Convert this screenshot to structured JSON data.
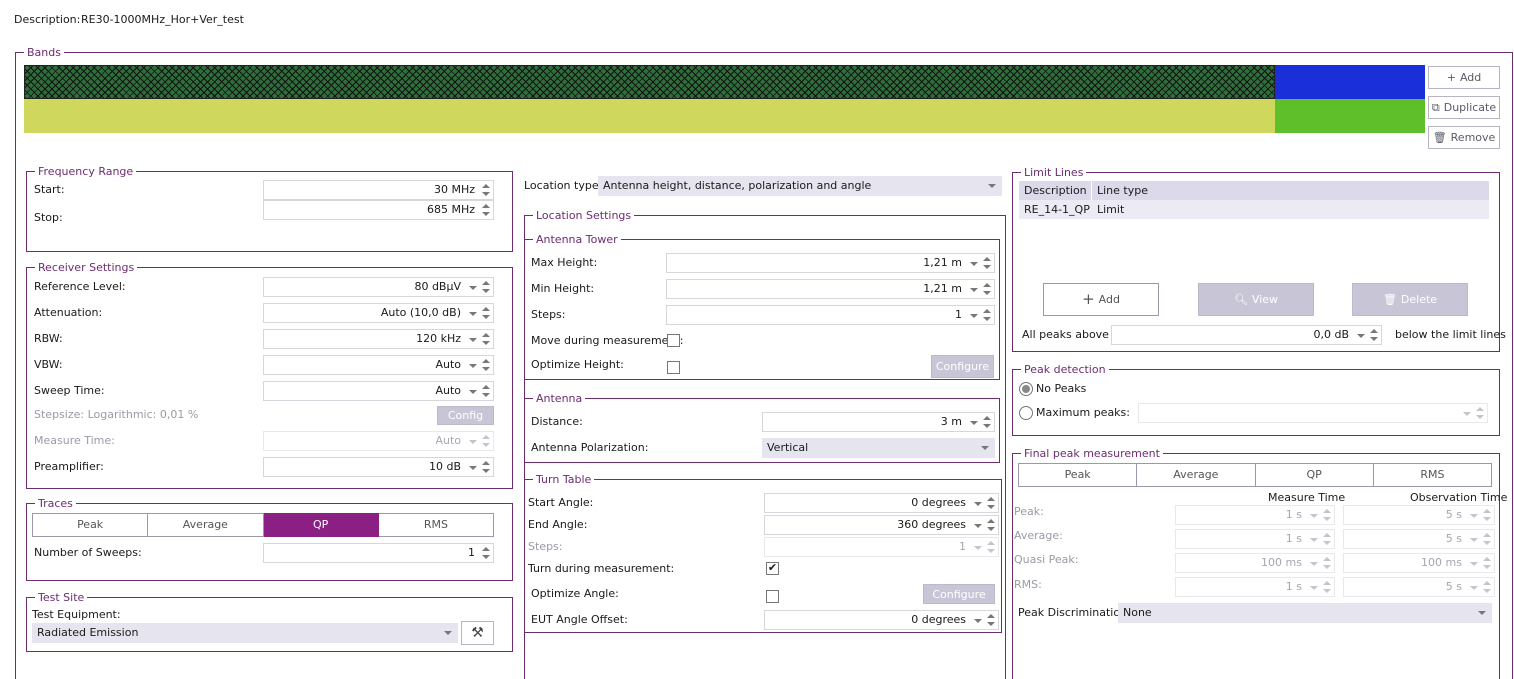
{
  "description": {
    "label": "Description:",
    "value": "RE30-1000MHz_Hor+Ver_test"
  },
  "bands": {
    "title": "Bands",
    "add": "Add",
    "duplicate": "Duplicate",
    "remove": "Remove",
    "colors": {
      "hatch": "#2e6e3a",
      "blue": "#1a2fd8",
      "yellow": "#cfd85c",
      "green": "#5fbf2a"
    }
  },
  "frequency": {
    "title": "Frequency Range",
    "start_label": "Start:",
    "start_value": "30 MHz",
    "stop_label": "Stop:",
    "stop_value": "685 MHz"
  },
  "receiver": {
    "title": "Receiver Settings",
    "ref_label": "Reference Level:",
    "ref_value": "80 dBµV",
    "att_label": "Attenuation:",
    "att_value": "Auto (10,0 dB)",
    "rbw_label": "RBW:",
    "rbw_value": "120 kHz",
    "vbw_label": "VBW:",
    "vbw_value": "Auto",
    "sweep_label": "Sweep Time:",
    "sweep_value": "Auto",
    "stepsize_label": "Stepsize: Logarithmic: 0,01 %",
    "config": "Config",
    "measure_label": "Measure Time:",
    "measure_value": "Auto",
    "preamp_label": "Preamplifier:",
    "preamp_value": "10 dB"
  },
  "traces": {
    "title": "Traces",
    "tabs": [
      "Peak",
      "Average",
      "QP",
      "RMS"
    ],
    "active": "QP",
    "sweeps_label": "Number of Sweeps:",
    "sweeps_value": "1"
  },
  "testsite": {
    "title": "Test Site",
    "equip_label": "Test Equipment:",
    "equip_value": "Radiated Emission"
  },
  "location": {
    "type_label": "Location type:",
    "type_value": "Antenna height, distance, polarization and angle",
    "settings_title": "Location Settings"
  },
  "tower": {
    "title": "Antenna Tower",
    "max_label": "Max Height:",
    "max_value": "1,21 m",
    "min_label": "Min Height:",
    "min_value": "1,21 m",
    "steps_label": "Steps:",
    "steps_value": "1",
    "move_label": "Move during measurement:",
    "opt_label": "Optimize Height:",
    "configure": "Configure"
  },
  "antenna": {
    "title": "Antenna",
    "dist_label": "Distance:",
    "dist_value": "3 m",
    "pol_label": "Antenna Polarization:",
    "pol_value": "Vertical"
  },
  "turntable": {
    "title": "Turn Table",
    "start_label": "Start Angle:",
    "start_value": "0 degrees",
    "end_label": "End Angle:",
    "end_value": "360 degrees",
    "steps_label": "Steps:",
    "steps_value": "1",
    "turn_label": "Turn during measurement:",
    "opt_label": "Optimize Angle:",
    "configure": "Configure",
    "offset_label": "EUT Angle Offset:",
    "offset_value": "0 degrees"
  },
  "limits": {
    "title": "Limit Lines",
    "col_desc": "Description",
    "col_type": "Line type",
    "rows": [
      {
        "desc": "RE_14-1_QP",
        "type": "Limit"
      }
    ],
    "add": "Add",
    "view": "View",
    "delete": "Delete",
    "peaks_label": "All peaks above",
    "peaks_value": "0,0 dB",
    "below_label": "below the limit lines"
  },
  "peakdet": {
    "title": "Peak detection",
    "no_peaks": "No Peaks",
    "max_peaks": "Maximum peaks:"
  },
  "final": {
    "title": "Final peak measurement",
    "tabs": [
      "Peak",
      "Average",
      "QP",
      "RMS"
    ],
    "col_measure": "Measure Time",
    "col_obs": "Observation Time",
    "rows": [
      {
        "label": "Peak:",
        "m": "1 s",
        "o": "5 s"
      },
      {
        "label": "Average:",
        "m": "1 s",
        "o": "5 s"
      },
      {
        "label": "Quasi Peak:",
        "m": "100 ms",
        "o": "100 ms"
      },
      {
        "label": "RMS:",
        "m": "1 s",
        "o": "5 s"
      }
    ],
    "disc_label": "Peak Discrimination:",
    "disc_value": "None"
  }
}
